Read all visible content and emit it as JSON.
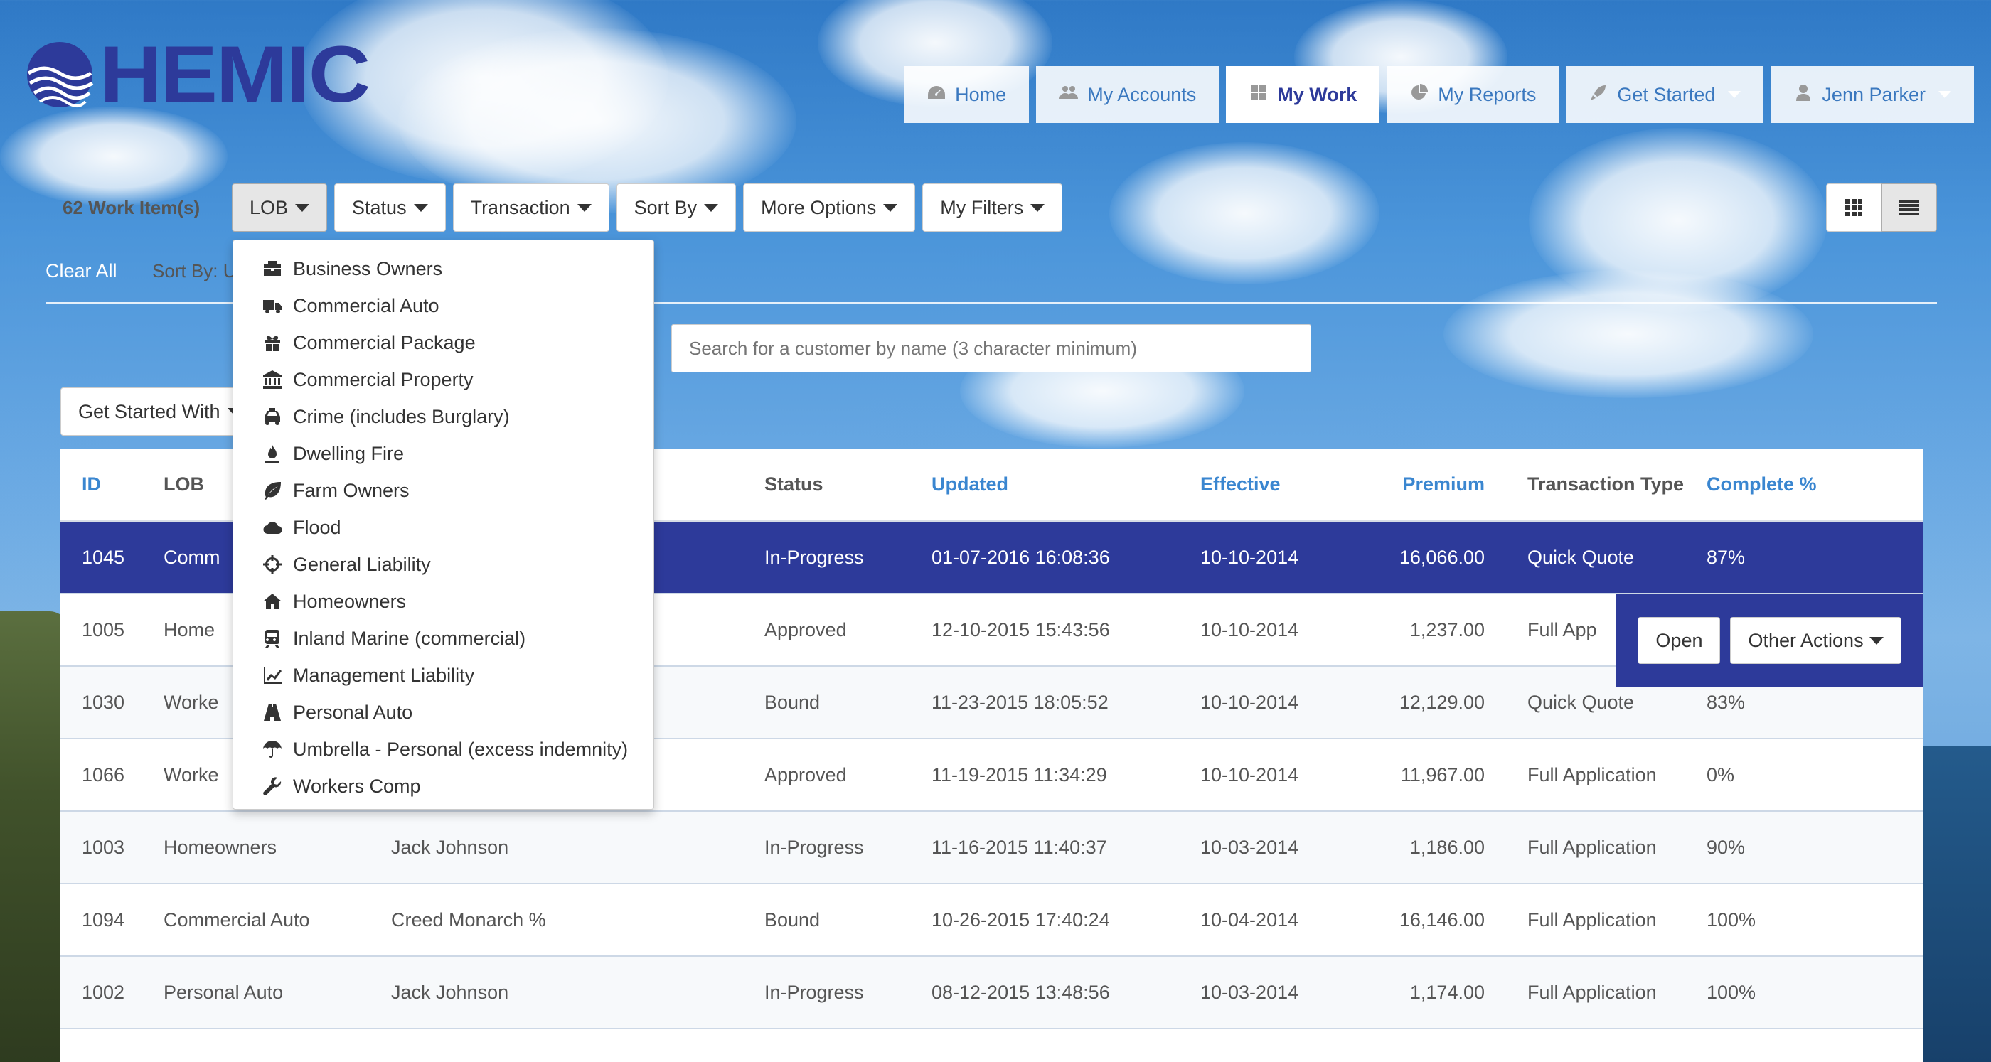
{
  "brand": {
    "name": "HEMIC",
    "color": "#2d3a9a"
  },
  "nav": [
    {
      "icon": "dashboard-icon",
      "label": "Home"
    },
    {
      "icon": "users-icon",
      "label": "My Accounts"
    },
    {
      "icon": "grid-icon",
      "label": "My Work",
      "active": true
    },
    {
      "icon": "pie-chart-icon",
      "label": "My Reports"
    },
    {
      "icon": "rocket-icon",
      "label": "Get Started"
    },
    {
      "icon": "user-icon",
      "label": "Jenn Parker"
    }
  ],
  "toolbar": {
    "count": "62 Work Item(s)",
    "filters": [
      "LOB",
      "Status",
      "Transaction",
      "Sort By",
      "More Options",
      "My Filters"
    ],
    "clear_all": "Clear All",
    "sort_by": "Sort By: U"
  },
  "search": {
    "placeholder": "Search for a customer by name (3 character minimum)"
  },
  "get_started_with": "Get Started With",
  "table": {
    "headers": [
      "ID",
      "LOB",
      "",
      "Status",
      "Updated",
      "Effective",
      "Premium",
      "Transaction Type",
      "Complete %"
    ],
    "rows": [
      {
        "id": "1045",
        "lob": "Comm",
        "account": "",
        "status": "In-Progress",
        "updated": "01-07-2016 16:08:36",
        "effective": "10-10-2014",
        "premium": "16,066.00",
        "type": "Quick Quote",
        "complete": "87%"
      },
      {
        "id": "1005",
        "lob": "Home",
        "account": "",
        "status": "Approved",
        "updated": "12-10-2015 15:43:56",
        "effective": "10-10-2014",
        "premium": "1,237.00",
        "type": "Full App",
        "complete": ""
      },
      {
        "id": "1030",
        "lob": "Worke",
        "account": "",
        "status": "Bound",
        "updated": "11-23-2015 18:05:52",
        "effective": "10-10-2014",
        "premium": "12,129.00",
        "type": "Quick Quote",
        "complete": "83%"
      },
      {
        "id": "1066",
        "lob": "Worke",
        "account": "",
        "status": "Approved",
        "updated": "11-19-2015 11:34:29",
        "effective": "10-10-2014",
        "premium": "11,967.00",
        "type": "Full Application",
        "complete": "0%"
      },
      {
        "id": "1003",
        "lob": "Homeowners",
        "account": "Jack Johnson",
        "status": "In-Progress",
        "updated": "11-16-2015 11:40:37",
        "effective": "10-03-2014",
        "premium": "1,186.00",
        "type": "Full Application",
        "complete": "90%"
      },
      {
        "id": "1094",
        "lob": "Commercial Auto",
        "account": "Creed Monarch %",
        "status": "Bound",
        "updated": "10-26-2015 17:40:24",
        "effective": "10-04-2014",
        "premium": "16,146.00",
        "type": "Full Application",
        "complete": "100%"
      },
      {
        "id": "1002",
        "lob": "Personal Auto",
        "account": "Jack Johnson",
        "status": "In-Progress",
        "updated": "08-12-2015 13:48:56",
        "effective": "10-03-2014",
        "premium": "1,174.00",
        "type": "Full Application",
        "complete": "100%"
      }
    ]
  },
  "row_actions": {
    "open": "Open",
    "other": "Other Actions"
  },
  "lob_menu": [
    {
      "icon": "briefcase-icon",
      "label": "Business Owners"
    },
    {
      "icon": "truck-icon",
      "label": "Commercial Auto"
    },
    {
      "icon": "gift-icon",
      "label": "Commercial Package"
    },
    {
      "icon": "bank-icon",
      "label": "Commercial Property"
    },
    {
      "icon": "taxi-icon",
      "label": "Crime (includes Burglary)"
    },
    {
      "icon": "fire-extinguisher-icon",
      "label": "Dwelling Fire"
    },
    {
      "icon": "leaf-icon",
      "label": "Farm Owners"
    },
    {
      "icon": "cloud-icon",
      "label": "Flood"
    },
    {
      "icon": "crosshairs-icon",
      "label": "General Liability"
    },
    {
      "icon": "home-icon",
      "label": "Homeowners"
    },
    {
      "icon": "train-icon",
      "label": "Inland Marine (commercial)"
    },
    {
      "icon": "line-chart-icon",
      "label": "Management Liability"
    },
    {
      "icon": "road-icon",
      "label": "Personal Auto"
    },
    {
      "icon": "umbrella-icon",
      "label": "Umbrella - Personal (excess indemnity)"
    },
    {
      "icon": "wrench-icon",
      "label": "Workers Comp"
    }
  ]
}
